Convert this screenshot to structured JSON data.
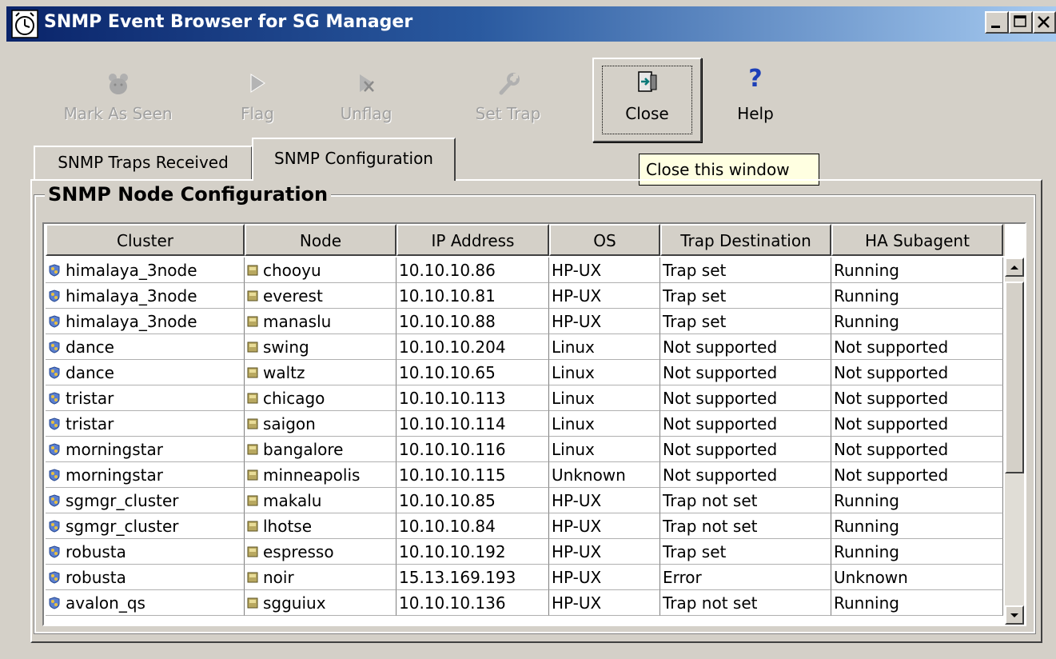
{
  "window": {
    "title": "SNMP Event Browser for SG Manager",
    "icon": "clock-icon",
    "controls": [
      "minimize",
      "maximize",
      "close"
    ]
  },
  "toolbar": {
    "mark_as_seen": "Mark As Seen",
    "flag": "Flag",
    "unflag": "Unflag",
    "set_trap": "Set Trap",
    "close": "Close",
    "help": "Help",
    "help_glyph": "?"
  },
  "tooltip": "Close this window",
  "tabs": [
    {
      "label": "SNMP Traps Received",
      "selected": false
    },
    {
      "label": "SNMP Configuration",
      "selected": true
    }
  ],
  "section_title": "SNMP Node Configuration",
  "table": {
    "columns": [
      "Cluster",
      "Node",
      "IP Address",
      "OS",
      "Trap Destination",
      "HA Subagent"
    ],
    "rows": [
      [
        "himalaya_3node",
        "chooyu",
        "10.10.10.86",
        "HP-UX",
        "Trap set",
        "Running"
      ],
      [
        "himalaya_3node",
        "everest",
        "10.10.10.81",
        "HP-UX",
        "Trap set",
        "Running"
      ],
      [
        "himalaya_3node",
        "manaslu",
        "10.10.10.88",
        "HP-UX",
        "Trap set",
        "Running"
      ],
      [
        "dance",
        "swing",
        "10.10.10.204",
        "Linux",
        "Not supported",
        "Not supported"
      ],
      [
        "dance",
        "waltz",
        "10.10.10.65",
        "Linux",
        "Not supported",
        "Not supported"
      ],
      [
        "tristar",
        "chicago",
        "10.10.10.113",
        "Linux",
        "Not supported",
        "Not supported"
      ],
      [
        "tristar",
        "saigon",
        "10.10.10.114",
        "Linux",
        "Not supported",
        "Not supported"
      ],
      [
        "morningstar",
        "bangalore",
        "10.10.10.116",
        "Linux",
        "Not supported",
        "Not supported"
      ],
      [
        "morningstar",
        "minneapolis",
        "10.10.10.115",
        "Unknown",
        "Not supported",
        "Not supported"
      ],
      [
        "sgmgr_cluster",
        "makalu",
        "10.10.10.85",
        "HP-UX",
        "Trap not set",
        "Running"
      ],
      [
        "sgmgr_cluster",
        "lhotse",
        "10.10.10.84",
        "HP-UX",
        "Trap not set",
        "Running"
      ],
      [
        "robusta",
        "espresso",
        "10.10.10.192",
        "HP-UX",
        "Trap set",
        "Running"
      ],
      [
        "robusta",
        "noir",
        "15.13.169.193",
        "HP-UX",
        "Error",
        "Unknown"
      ],
      [
        "avalon_qs",
        "sgguiux",
        "10.10.10.136",
        "HP-UX",
        "Trap not set",
        "Running"
      ]
    ]
  },
  "colors": {
    "title_gradient_start": "#0a246a",
    "title_gradient_end": "#a6caf0",
    "face": "#d4d0c8",
    "tooltip_bg": "#ffffe1",
    "help_icon": "#1c3fb8"
  }
}
